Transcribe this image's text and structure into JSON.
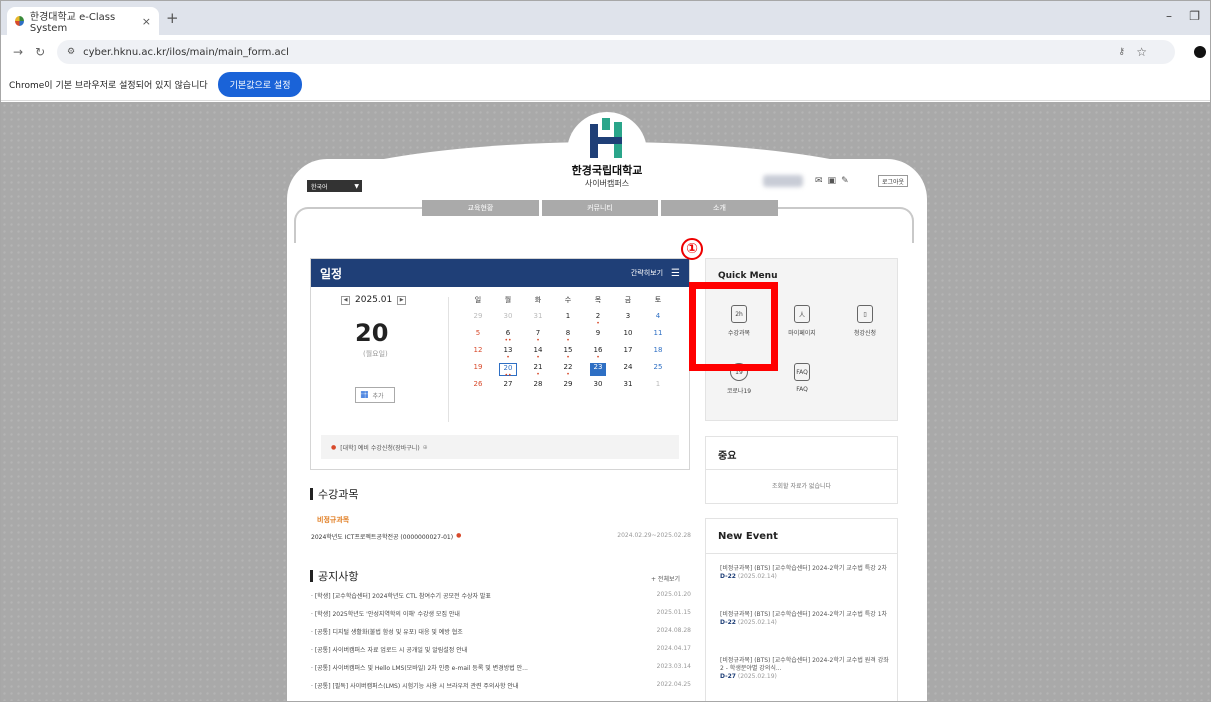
{
  "browser": {
    "tab_title": "한경대학교 e-Class System",
    "tab_close": "×",
    "new_tab": "+",
    "minimize": "–",
    "restore": "❐",
    "url": "cyber.hknu.ac.kr/ilos/main/main_form.acl",
    "infobar_message": "Chrome이 기본 브라우저로 설정되어 있지 않습니다",
    "infobar_button": "기본값으로 설정"
  },
  "site": {
    "title": "한경국립대학교",
    "subtitle": "사이버캠퍼스",
    "language": "한국어",
    "logout": "로그아웃",
    "menu": [
      "교육현황",
      "커뮤니티",
      "소개"
    ]
  },
  "schedule": {
    "title": "일정",
    "brief_view": "간략히보기",
    "month": "2025.01",
    "day": "20",
    "weekday": "(월요일)",
    "add_label": "추가",
    "weekdays": [
      "일",
      "월",
      "화",
      "수",
      "목",
      "금",
      "토"
    ],
    "weeks": [
      [
        "29",
        "30",
        "31",
        "1",
        "2",
        "3",
        "4"
      ],
      [
        "5",
        "6",
        "7",
        "8",
        "9",
        "10",
        "11"
      ],
      [
        "12",
        "13",
        "14",
        "15",
        "16",
        "17",
        "18"
      ],
      [
        "19",
        "20",
        "21",
        "22",
        "23",
        "24",
        "25"
      ],
      [
        "26",
        "27",
        "28",
        "29",
        "30",
        "31",
        "1"
      ]
    ],
    "event_text": "[대학] 예비 수강신청(장바구니)"
  },
  "quick_menu": {
    "title": "Quick Menu",
    "items": [
      {
        "label": "수강과목",
        "icon": "course-icon",
        "glyph": "2h"
      },
      {
        "label": "마이페이지",
        "icon": "mypage-icon",
        "glyph": "人"
      },
      {
        "label": "청강신청",
        "icon": "audit-icon",
        "glyph": "▯"
      },
      {
        "label": "코로나19",
        "icon": "covid-icon",
        "glyph": "19"
      },
      {
        "label": "FAQ",
        "icon": "faq-icon",
        "glyph": "FAQ"
      }
    ],
    "annotation": "①"
  },
  "important": {
    "title": "중요",
    "empty": "조회할 자료가 없습니다"
  },
  "new_event": {
    "title": "New Event",
    "events": [
      {
        "title": "[비정규과목] (BTS) [교수학습센터] 2024-2학기 교수법 특강 2차",
        "dday": "D-22",
        "date": "(2025.02.14)"
      },
      {
        "title": "[비정규과목] (BTS) [교수학습센터] 2024-2학기 교수법 특강 1차",
        "dday": "D-22",
        "date": "(2025.02.14)"
      },
      {
        "title": "[비정규과목] (BTS) [교수학습센터] 2024-2학기 교수법 원격 강좌 2 - 학생분야별 강의식...",
        "dday": "D-27",
        "date": "(2025.02.19)"
      }
    ]
  },
  "courses": {
    "title": "수강과목",
    "irregular_label": "비정규과목",
    "course_name": "2024학년도 ICT프로젝트공학전공 (0000000027-01)",
    "course_range": "2024.02.29~2025.02.28"
  },
  "notices": {
    "title": "공지사항",
    "more": "+ 전체보기",
    "items": [
      {
        "text": "· [학생] [교수학습센터] 2024학년도 CTL 참여수기 공모전 수상자 발표",
        "date": "2025.01.20"
      },
      {
        "text": "· [학생] 2025학년도 '안성지역학의 이해' 수강생 모집 안내",
        "date": "2025.01.15"
      },
      {
        "text": "· [공통] 디지털 생활화(불법 함성 및 유포) 대응 및 예방 협조",
        "date": "2024.08.28"
      },
      {
        "text": "· [공통] 사이버캠퍼스 자료 업로드 시 공개일 및 알림설정 안내",
        "date": "2024.04.17"
      },
      {
        "text": "· [공통] 사이버캠퍼스 및 Hello LMS(모바일) 2차 인증 e-mail 등록 및 변경방법 안...",
        "date": "2023.03.14"
      },
      {
        "text": "· [공통] [필독] 사이버캠퍼스(LMS) 시험기능 사용 시 브라우저 관련 주의사항 안내",
        "date": "2022.04.25"
      }
    ]
  }
}
